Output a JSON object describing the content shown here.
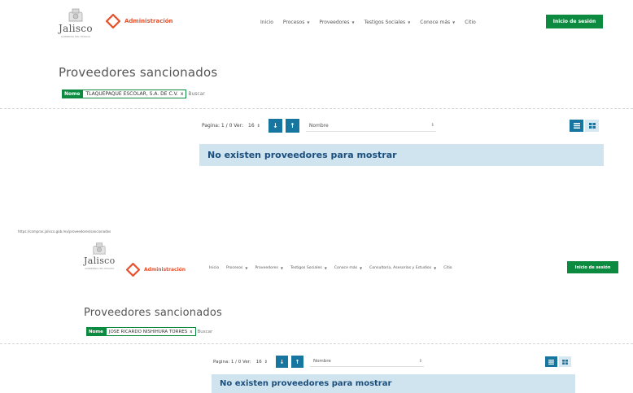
{
  "frames": [
    {
      "logo_text": "Jalisco",
      "logo_sub": "GOBIERNO DEL ESTADO",
      "admin_label": "Administración",
      "menu": [
        {
          "label": "Inicio",
          "dropdown": false
        },
        {
          "label": "Procesos",
          "dropdown": true
        },
        {
          "label": "Proveedores",
          "dropdown": true
        },
        {
          "label": "Testigos Sociales",
          "dropdown": true
        },
        {
          "label": "Conoce más",
          "dropdown": true
        },
        {
          "label": "Citio",
          "dropdown": false
        }
      ],
      "login_label": "Inicio de sesión",
      "page_title": "Proveedores sancionados",
      "filter_tag": "Nome",
      "filter_value": "TLAQUEPAQUE ESCOLAR, S.A. DE C.V.",
      "filter_remove": "x",
      "filter_search": "Buscar",
      "pagination": "Pagina: 1 / 0 Ver:",
      "per_page": "16",
      "sort_asc": "↓",
      "sort_desc": "↑",
      "sort_field": "Nombre",
      "notice": "No existen proveedores para mostrar"
    },
    {
      "logo_text": "Jalisco",
      "logo_sub": "GOBIERNO DEL ESTADO",
      "admin_label": "Administración",
      "menu": [
        {
          "label": "Inicio",
          "dropdown": false
        },
        {
          "label": "Procesos",
          "dropdown": true
        },
        {
          "label": "Proveedores",
          "dropdown": true
        },
        {
          "label": "Testigos Sociales",
          "dropdown": true
        },
        {
          "label": "Conoce más",
          "dropdown": true
        },
        {
          "label": "Consultoría, Asesorías y Estudios",
          "dropdown": true
        },
        {
          "label": "Citio",
          "dropdown": false
        }
      ],
      "login_label": "Inicio de sesión",
      "page_title": "Proveedores sancionados",
      "filter_tag": "Nome",
      "filter_value": "JOSE RICARDO NISHIHURA TORRES",
      "filter_remove": "x",
      "filter_search": "Buscar",
      "pagination": "Pagina: 1 / 0 Ver:",
      "per_page": "16",
      "sort_asc": "↓",
      "sort_desc": "↑",
      "sort_field": "Nombre",
      "notice": "No existen proveedores para mostrar"
    }
  ],
  "url_bar": "https://compras.jalisco.gob.mx/proveedores/sancionados",
  "colors": {
    "brand_green": "#0c8a3f",
    "admin_orange": "#e8502b",
    "accent_blue": "#16769f",
    "notice_bg": "#cfe4ef",
    "notice_text": "#1b4e7c"
  },
  "icons": {
    "logo": "jalisco-crest-icon",
    "admin": "admin-diamond-icon",
    "view_list": "list-view-icon",
    "view_grid": "grid-view-icon"
  }
}
